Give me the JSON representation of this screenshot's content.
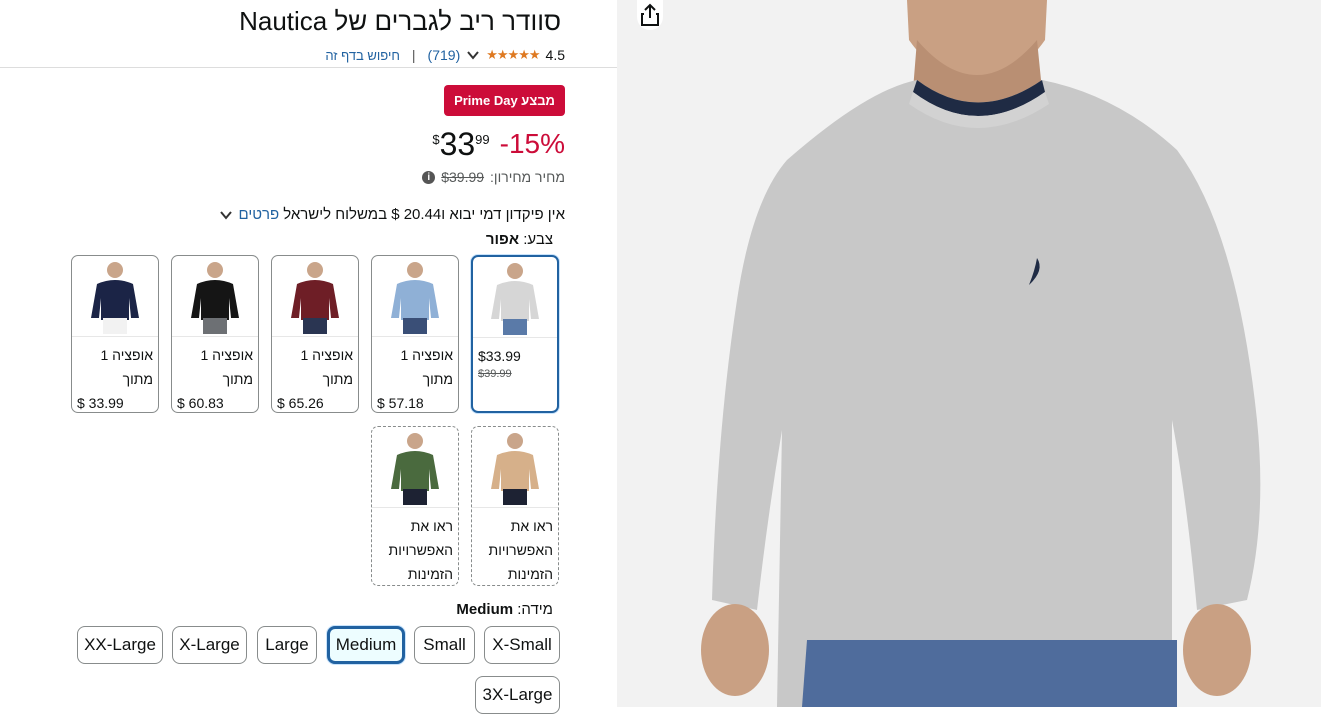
{
  "product": {
    "title": "סוודר ריב לגברים של Nautica",
    "rating_value": "4.5",
    "stars": "★★★★★",
    "review_count": "(719)",
    "search_link": "חיפוש בדף זה",
    "deal_badge": "מבצע Prime Day",
    "discount": "-15%",
    "price_currency": "$",
    "price_whole": "33",
    "price_fraction": "99",
    "list_price_label": "מחיר מחירון:",
    "list_price": "$39.99",
    "shipping_text": "אין פיקדון דמי יבוא ו20.44 $ במשלוח לישראל",
    "shipping_details_link": "פרטים"
  },
  "color": {
    "label": "צבע:",
    "selected": "אפור",
    "options": [
      {
        "name": "grey",
        "price": "$33.99",
        "old_price": "$39.99",
        "sweater": "#d6d6d6",
        "pants": "#5a7aa8",
        "skin": "#c9a58a"
      },
      {
        "name": "light-blue",
        "line1": "אופציה 1",
        "line2": "מתוך",
        "price": "$ 57.18",
        "sweater": "#8fb0d6",
        "pants": "#3a4f77",
        "skin": "#c9a58a"
      },
      {
        "name": "burgundy",
        "line1": "אופציה 1",
        "line2": "מתוך",
        "price": "$ 65.26",
        "sweater": "#6e1e26",
        "pants": "#2a3552",
        "skin": "#c9a58a"
      },
      {
        "name": "black",
        "line1": "אופציה 1",
        "line2": "מתוך",
        "price": "$ 60.83",
        "sweater": "#151515",
        "pants": "#6d7074",
        "skin": "#c9a58a"
      },
      {
        "name": "navy",
        "line1": "אופציה 1",
        "line2": "מתוך",
        "price": "$ 33.99",
        "sweater": "#1b2446",
        "pants": "#f2f2f2",
        "skin": "#c9a58a"
      },
      {
        "name": "camel",
        "line1": "ראו את",
        "line2": "האפשרויות",
        "line3": "הזמינות",
        "sweater": "#d6b08a",
        "pants": "#1d2233",
        "skin": "#c9a58a"
      },
      {
        "name": "green",
        "line1": "ראו את",
        "line2": "האפשרויות",
        "line3": "הזמינות",
        "sweater": "#4a6a3e",
        "pants": "#1d2233",
        "skin": "#c9a58a"
      }
    ]
  },
  "size": {
    "label": "מידה:",
    "selected": "Medium",
    "options": [
      "X-Small",
      "Small",
      "Medium",
      "Large",
      "X-Large",
      "XX-Large",
      "3X-Large"
    ]
  },
  "icons": {
    "share": "share-icon",
    "info": "info-icon",
    "chevron": "chevron-down-icon"
  },
  "colors": {
    "accent": "#2162a1",
    "deal": "#cc0c39",
    "stars": "#de7921"
  }
}
